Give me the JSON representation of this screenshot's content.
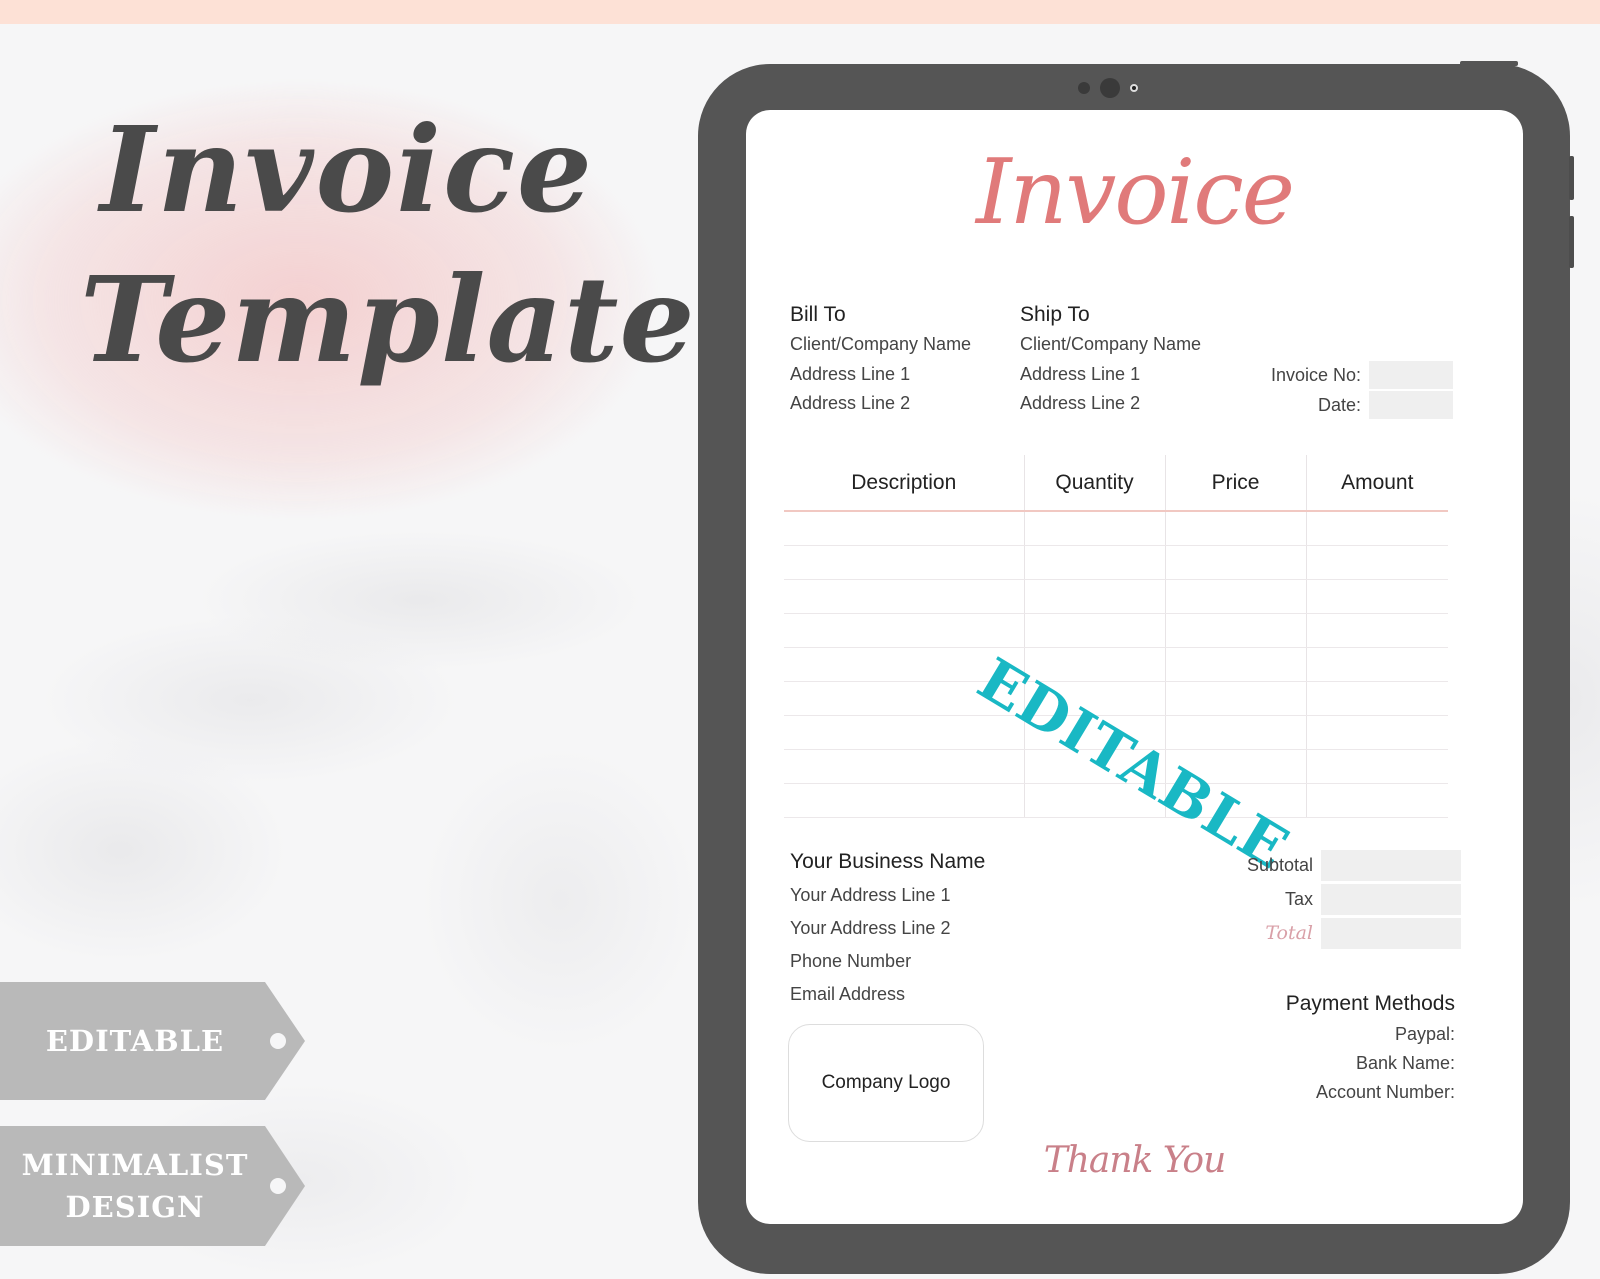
{
  "hero": {
    "title_line1": "Invoice",
    "title_line2": "Template"
  },
  "tags": [
    {
      "label": "EDITABLE"
    },
    {
      "label_line1": "MINIMALIST",
      "label_line2": "DESIGN"
    }
  ],
  "invoice": {
    "title": "Invoice",
    "bill_to": {
      "heading": "Bill To",
      "lines": [
        "Client/Company Name",
        "Address Line 1",
        "Address Line 2"
      ]
    },
    "ship_to": {
      "heading": "Ship To",
      "lines": [
        "Client/Company Name",
        "Address Line 1",
        "Address Line 2"
      ]
    },
    "meta": {
      "invoice_no_label": "Invoice No:",
      "invoice_no_value": "",
      "date_label": "Date:",
      "date_value": ""
    },
    "table": {
      "columns": [
        "Description",
        "Quantity",
        "Price",
        "Amount"
      ],
      "row_count": 9
    },
    "stamp": "EDITABLE",
    "business": {
      "name": "Your Business Name",
      "lines": [
        "Your Address Line 1",
        "Your Address Line 2",
        "Phone Number",
        "Email Address"
      ]
    },
    "totals": {
      "subtotal_label": "Subtotal",
      "tax_label": "Tax",
      "total_label": "Total"
    },
    "logo_placeholder": "Company Logo",
    "payment": {
      "heading": "Payment Methods",
      "lines": [
        "Paypal:",
        "Bank Name:",
        "Account Number:"
      ]
    },
    "thanks": "Thank You"
  },
  "colors": {
    "accent_pink": "#e07a7a",
    "stamp_teal": "#19b8c4",
    "tablet_frame": "#555555",
    "tag_gray": "#b9b9b9",
    "top_strip": "#fde1d6"
  }
}
